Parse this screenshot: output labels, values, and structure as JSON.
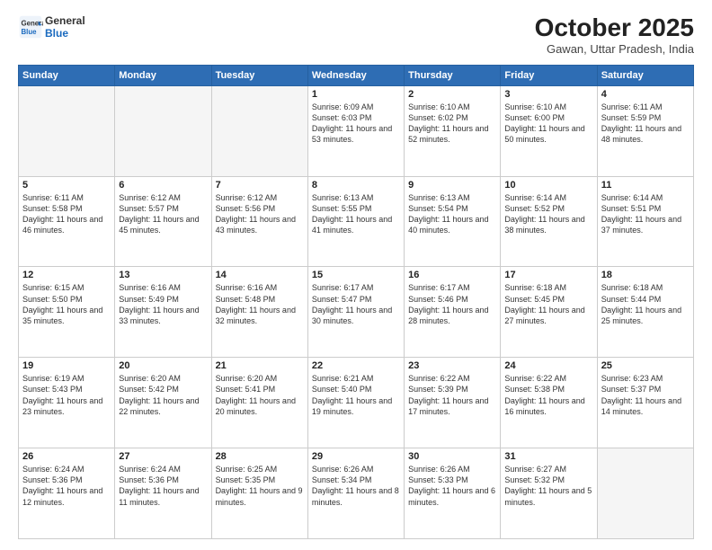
{
  "header": {
    "logo_general": "General",
    "logo_blue": "Blue",
    "month_title": "October 2025",
    "location": "Gawan, Uttar Pradesh, India"
  },
  "days_of_week": [
    "Sunday",
    "Monday",
    "Tuesday",
    "Wednesday",
    "Thursday",
    "Friday",
    "Saturday"
  ],
  "weeks": [
    [
      {
        "day": "",
        "empty": true
      },
      {
        "day": "",
        "empty": true
      },
      {
        "day": "",
        "empty": true
      },
      {
        "day": "1",
        "sunrise": "6:09 AM",
        "sunset": "6:03 PM",
        "daylight": "11 hours and 53 minutes."
      },
      {
        "day": "2",
        "sunrise": "6:10 AM",
        "sunset": "6:02 PM",
        "daylight": "11 hours and 52 minutes."
      },
      {
        "day": "3",
        "sunrise": "6:10 AM",
        "sunset": "6:00 PM",
        "daylight": "11 hours and 50 minutes."
      },
      {
        "day": "4",
        "sunrise": "6:11 AM",
        "sunset": "5:59 PM",
        "daylight": "11 hours and 48 minutes."
      }
    ],
    [
      {
        "day": "5",
        "sunrise": "6:11 AM",
        "sunset": "5:58 PM",
        "daylight": "11 hours and 46 minutes."
      },
      {
        "day": "6",
        "sunrise": "6:12 AM",
        "sunset": "5:57 PM",
        "daylight": "11 hours and 45 minutes."
      },
      {
        "day": "7",
        "sunrise": "6:12 AM",
        "sunset": "5:56 PM",
        "daylight": "11 hours and 43 minutes."
      },
      {
        "day": "8",
        "sunrise": "6:13 AM",
        "sunset": "5:55 PM",
        "daylight": "11 hours and 41 minutes."
      },
      {
        "day": "9",
        "sunrise": "6:13 AM",
        "sunset": "5:54 PM",
        "daylight": "11 hours and 40 minutes."
      },
      {
        "day": "10",
        "sunrise": "6:14 AM",
        "sunset": "5:52 PM",
        "daylight": "11 hours and 38 minutes."
      },
      {
        "day": "11",
        "sunrise": "6:14 AM",
        "sunset": "5:51 PM",
        "daylight": "11 hours and 37 minutes."
      }
    ],
    [
      {
        "day": "12",
        "sunrise": "6:15 AM",
        "sunset": "5:50 PM",
        "daylight": "11 hours and 35 minutes."
      },
      {
        "day": "13",
        "sunrise": "6:16 AM",
        "sunset": "5:49 PM",
        "daylight": "11 hours and 33 minutes."
      },
      {
        "day": "14",
        "sunrise": "6:16 AM",
        "sunset": "5:48 PM",
        "daylight": "11 hours and 32 minutes."
      },
      {
        "day": "15",
        "sunrise": "6:17 AM",
        "sunset": "5:47 PM",
        "daylight": "11 hours and 30 minutes."
      },
      {
        "day": "16",
        "sunrise": "6:17 AM",
        "sunset": "5:46 PM",
        "daylight": "11 hours and 28 minutes."
      },
      {
        "day": "17",
        "sunrise": "6:18 AM",
        "sunset": "5:45 PM",
        "daylight": "11 hours and 27 minutes."
      },
      {
        "day": "18",
        "sunrise": "6:18 AM",
        "sunset": "5:44 PM",
        "daylight": "11 hours and 25 minutes."
      }
    ],
    [
      {
        "day": "19",
        "sunrise": "6:19 AM",
        "sunset": "5:43 PM",
        "daylight": "11 hours and 23 minutes."
      },
      {
        "day": "20",
        "sunrise": "6:20 AM",
        "sunset": "5:42 PM",
        "daylight": "11 hours and 22 minutes."
      },
      {
        "day": "21",
        "sunrise": "6:20 AM",
        "sunset": "5:41 PM",
        "daylight": "11 hours and 20 minutes."
      },
      {
        "day": "22",
        "sunrise": "6:21 AM",
        "sunset": "5:40 PM",
        "daylight": "11 hours and 19 minutes."
      },
      {
        "day": "23",
        "sunrise": "6:22 AM",
        "sunset": "5:39 PM",
        "daylight": "11 hours and 17 minutes."
      },
      {
        "day": "24",
        "sunrise": "6:22 AM",
        "sunset": "5:38 PM",
        "daylight": "11 hours and 16 minutes."
      },
      {
        "day": "25",
        "sunrise": "6:23 AM",
        "sunset": "5:37 PM",
        "daylight": "11 hours and 14 minutes."
      }
    ],
    [
      {
        "day": "26",
        "sunrise": "6:24 AM",
        "sunset": "5:36 PM",
        "daylight": "11 hours and 12 minutes."
      },
      {
        "day": "27",
        "sunrise": "6:24 AM",
        "sunset": "5:36 PM",
        "daylight": "11 hours and 11 minutes."
      },
      {
        "day": "28",
        "sunrise": "6:25 AM",
        "sunset": "5:35 PM",
        "daylight": "11 hours and 9 minutes."
      },
      {
        "day": "29",
        "sunrise": "6:26 AM",
        "sunset": "5:34 PM",
        "daylight": "11 hours and 8 minutes."
      },
      {
        "day": "30",
        "sunrise": "6:26 AM",
        "sunset": "5:33 PM",
        "daylight": "11 hours and 6 minutes."
      },
      {
        "day": "31",
        "sunrise": "6:27 AM",
        "sunset": "5:32 PM",
        "daylight": "11 hours and 5 minutes."
      },
      {
        "day": "",
        "empty": true
      }
    ]
  ]
}
